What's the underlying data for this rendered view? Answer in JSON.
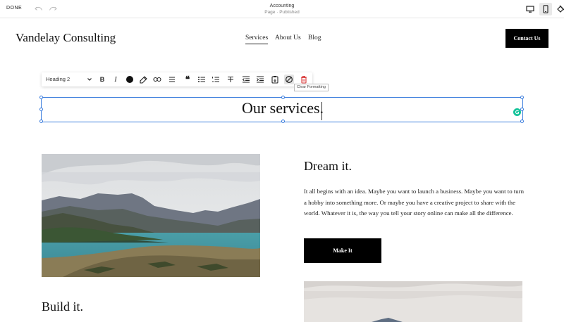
{
  "editor": {
    "done_label": "DONE",
    "page_title": "Accounting",
    "page_status": "Page · Published",
    "undo_icon": "undo-icon",
    "redo_icon": "redo-icon",
    "desktop_icon": "desktop-icon",
    "mobile_icon": "mobile-icon"
  },
  "site": {
    "title": "Vandelay Consulting",
    "nav": [
      "Services",
      "About Us",
      "Blog"
    ],
    "contact_label": "Contact Us"
  },
  "toolbar": {
    "block_type": "Heading 2",
    "buttons": [
      "bold-icon",
      "italic-icon",
      "text-color-icon",
      "text-highlight-icon",
      "link-icon",
      "strikethrough-icon",
      "blockquote-icon",
      "bulleted-list-icon",
      "numbered-list-icon",
      "text-align-icon",
      "outdent-icon",
      "indent-icon",
      "paste-icon",
      "clear-formatting-icon",
      "delete-icon"
    ],
    "tooltip": "Clear Formatting"
  },
  "heading": {
    "text": "Our services."
  },
  "section": {
    "dream_title": "Dream it.",
    "dream_body": "It all begins with an idea. Maybe you want to launch a business. Maybe you want to turn a hobby into something more. Or maybe you have a creative project to share with the world. Whatever it is, the way you tell your story online can make all the difference.",
    "make_label": "Make It",
    "build_title": "Build it."
  },
  "colors": {
    "selection": "#3b7ddd",
    "button_bg": "#000000",
    "delete_red": "#d93a3a",
    "grammarly": "#15c39a"
  }
}
